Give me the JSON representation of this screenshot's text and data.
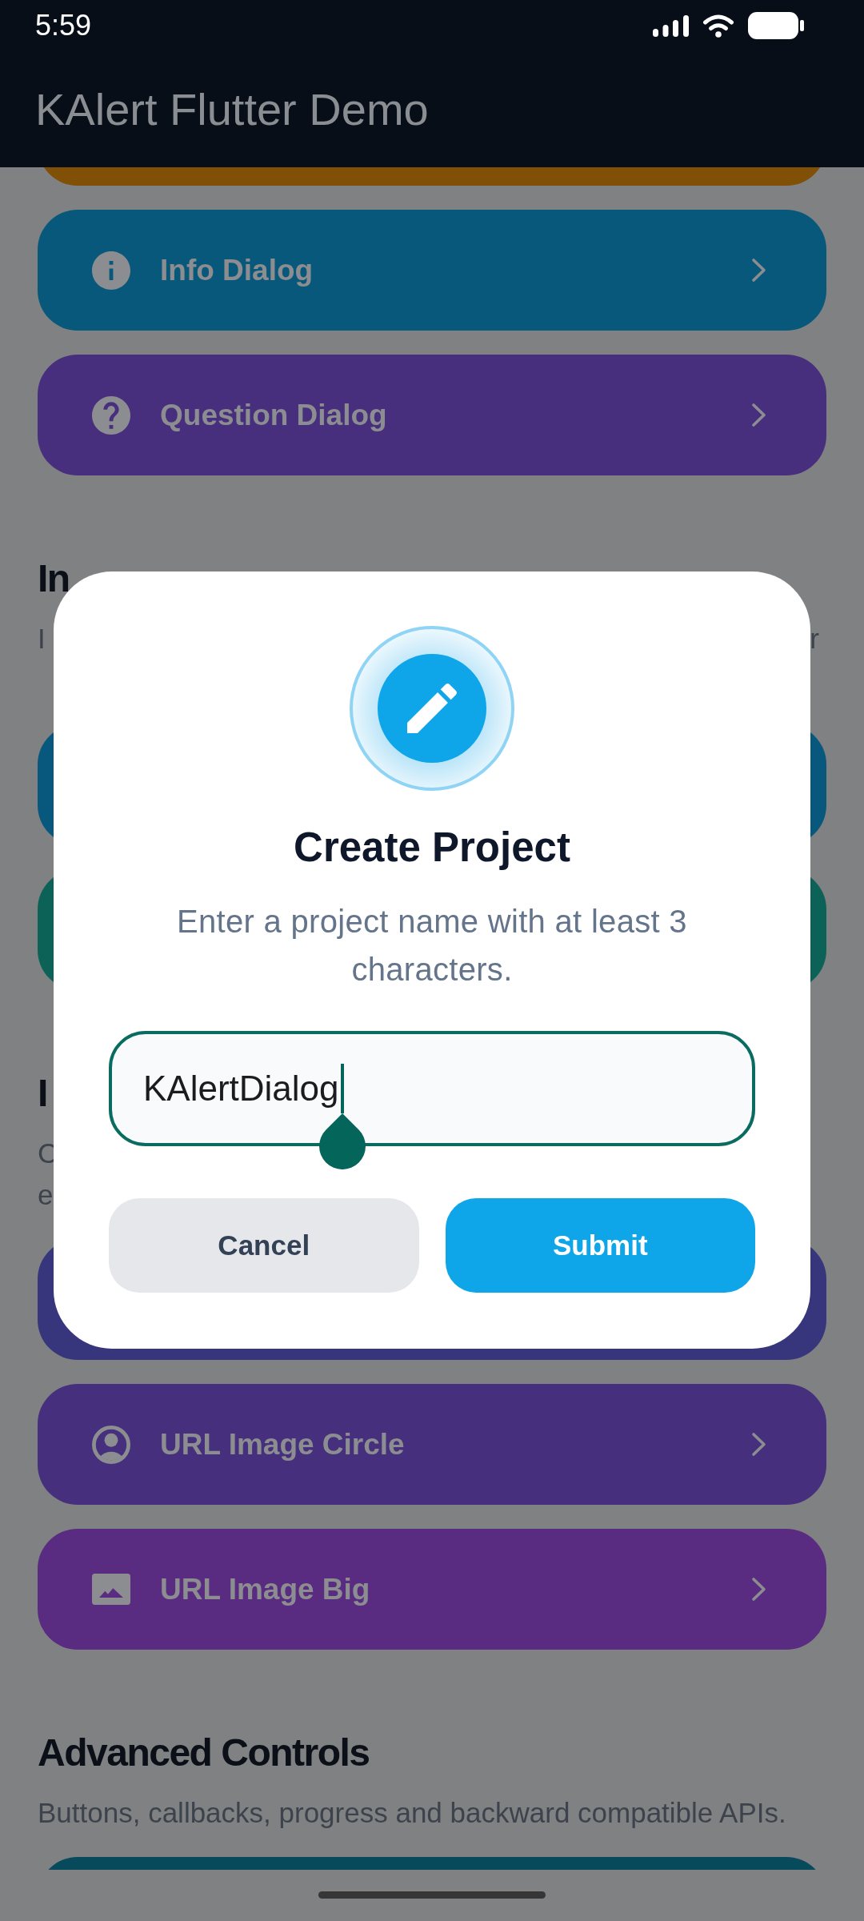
{
  "status_bar": {
    "time": "5:59"
  },
  "app_bar": {
    "title": "KAlert Flutter Demo"
  },
  "sections": [
    {
      "cards": [
        {
          "color": "#7f5006"
        },
        {
          "kind": "info",
          "label": "Info Dialog",
          "color": "#08587b"
        },
        {
          "kind": "question",
          "label": "Question Dialog",
          "color": "#472f7e"
        }
      ]
    },
    {
      "heading": "In",
      "description_lines": [
        {
          "kind": "text",
          "parts": [
            "I",
            "r"
          ]
        },
        {
          "kind": "covered"
        }
      ],
      "cards": [
        {
          "color": "#08577c"
        },
        {
          "color": "#0c6257"
        }
      ]
    },
    {
      "heading": "I",
      "description_lines": [
        {
          "kind": "text",
          "parts": [
            "C"
          ]
        },
        {
          "kind": "text",
          "parts": [
            "e"
          ]
        }
      ],
      "cards": [
        {
          "color": "#37357b"
        },
        {
          "kind": "avatar",
          "label": "URL Image Circle",
          "color": "#46307e"
        },
        {
          "kind": "image",
          "label": "URL Image Big",
          "color": "#5a2c81"
        }
      ]
    },
    {
      "heading": "Advanced Controls",
      "description_lines": [
        {
          "kind": "text",
          "parts": [
            "Buttons, callbacks, progress and backward compatible APIs."
          ]
        }
      ],
      "cards": [
        {
          "color": "#074a5b"
        }
      ]
    }
  ],
  "dialog": {
    "title": "Create Project",
    "message": "Enter a project name with at least 3 characters.",
    "input": {
      "value": "KAlertDialog",
      "focused": true
    },
    "buttons": [
      {
        "kind": "secondary",
        "label": "Cancel"
      },
      {
        "kind": "primary",
        "label": "Submit"
      }
    ]
  }
}
